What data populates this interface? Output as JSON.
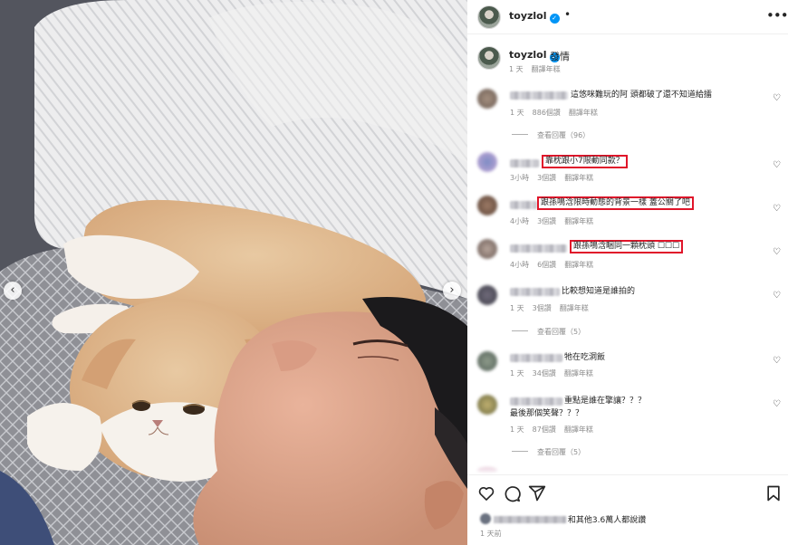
{
  "post": {
    "username": "toyzlol",
    "verified_glyph": "✓",
    "header_dot": "•",
    "more_icon": "more-horizontal-icon"
  },
  "caption": {
    "username": "toyzlol",
    "text": "發情",
    "time": "1 天",
    "translate": "翻譯年糕"
  },
  "comments": [
    {
      "text": "這悠咪難玩的阿 頭都破了還不知道給擂",
      "time": "1 天",
      "likes": "886個讚",
      "translate": "翻譯年糕",
      "replies": "查看回覆（96）",
      "highlighted": false
    },
    {
      "text": "靠枕跟小7限動同款？",
      "time": "3小時",
      "likes": "3個讚",
      "translate": "翻譯年糕",
      "highlighted": true
    },
    {
      "text": "跟孫鳴浛限時動態的背景一樣 蓋公關了吧",
      "time": "4小時",
      "likes": "3個讚",
      "translate": "翻譯年糕",
      "highlighted": true
    },
    {
      "text": "跟孫鳴浛睏同一顆枕頭 ☐☐☐",
      "time": "4小時",
      "likes": "6個讚",
      "translate": "翻譯年糕",
      "highlighted": true
    },
    {
      "text": "比較想知道是誰拍的",
      "time": "1 天",
      "likes": "3個讚",
      "translate": "翻譯年糕",
      "replies": "查看回覆（5）",
      "highlighted": false
    },
    {
      "text": "牠在吃洞飯",
      "time": "1 天",
      "likes": "34個讚",
      "translate": "翻譯年糕",
      "highlighted": false
    },
    {
      "text": "重點是誰在擎讓？？？",
      "text2": "最後那個笑聲？？？",
      "time": "1 天",
      "likes": "87個讚",
      "translate": "翻譯年糕",
      "replies": "查看回覆（5）",
      "highlighted": false
    }
  ],
  "actions": {
    "like_icon": "heart-icon",
    "comment_icon": "comment-icon",
    "share_icon": "send-icon",
    "save_icon": "bookmark-icon",
    "likes_text": "和其他3.6萬人都說讚",
    "time_ago": "1 天前"
  },
  "carousel": {
    "prev": "‹",
    "next": "›"
  },
  "colors": {
    "highlight_box": "#e0152a",
    "verified": "#0095f6",
    "muted": "#8e8e8e"
  }
}
